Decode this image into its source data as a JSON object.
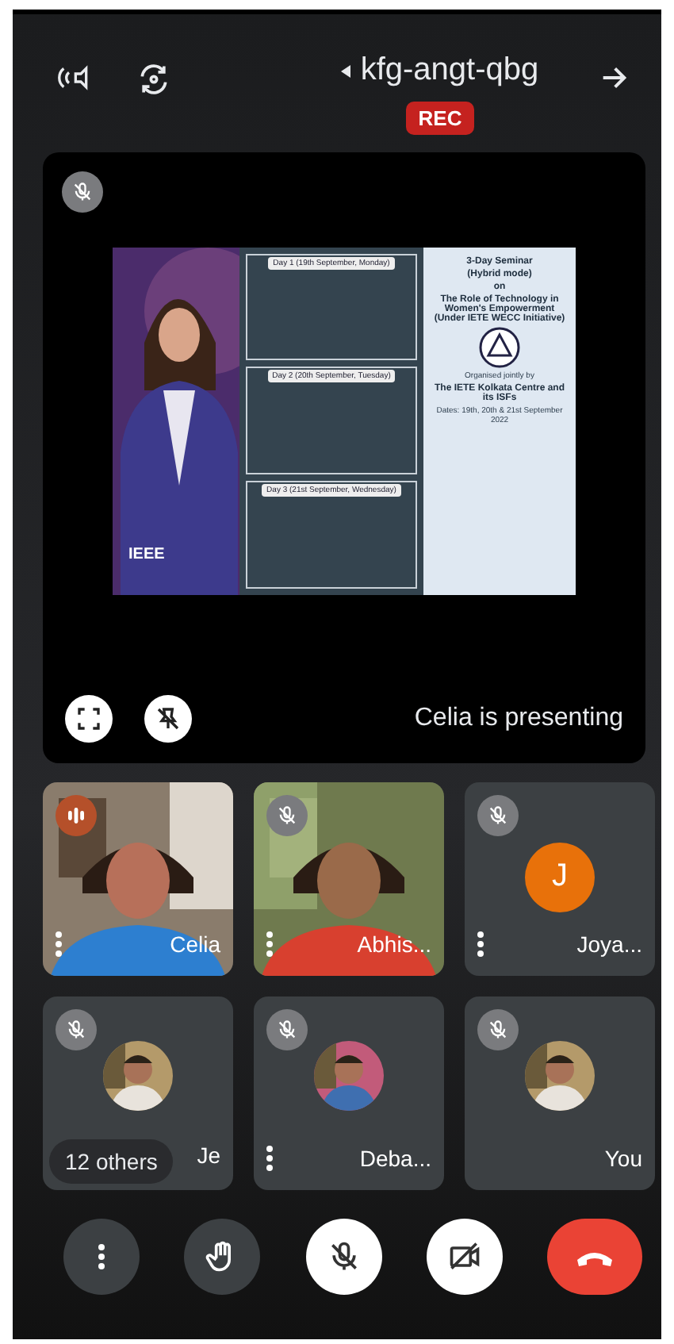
{
  "header": {
    "meeting_code": "kfg-angt-qbg",
    "recording_badge": "REC"
  },
  "presentation": {
    "muted": true,
    "caption": "Celia is presenting",
    "poster": {
      "title_lines": [
        "3-Day Seminar",
        "(Hybrid mode)",
        "on",
        "The Role of Technology in Women's Empowerment (Under IETE WECC Initiative)"
      ],
      "organiser": "Organised jointly by",
      "organiser_name": "The IETE Kolkata Centre and its ISFs",
      "dates": "Dates: 19th, 20th & 21st September 2022",
      "days": [
        "Day 1 (19th September, Monday)",
        "Day 2 (20th September, Tuesday)",
        "Day 3 (21st September, Wednesday)"
      ],
      "logo": "IEEE"
    }
  },
  "participants": [
    {
      "name": "Celia",
      "kind": "video",
      "muted": false,
      "speaking": true,
      "menu": true
    },
    {
      "name": "Abhis...",
      "kind": "video",
      "muted": true,
      "speaking": false,
      "menu": true
    },
    {
      "name": "Joya...",
      "kind": "initial",
      "initial": "J",
      "color": "#e8710a",
      "muted": true,
      "speaking": false,
      "menu": true
    },
    {
      "name": "Je",
      "muted": true,
      "speaking": false,
      "menu": false,
      "others": "12 others"
    },
    {
      "name": "Deba...",
      "muted": true,
      "speaking": false,
      "menu": true
    },
    {
      "name": "You",
      "muted": true,
      "speaking": false,
      "menu": false
    }
  ],
  "controls": {
    "mic_on": false,
    "camera_on": false
  }
}
